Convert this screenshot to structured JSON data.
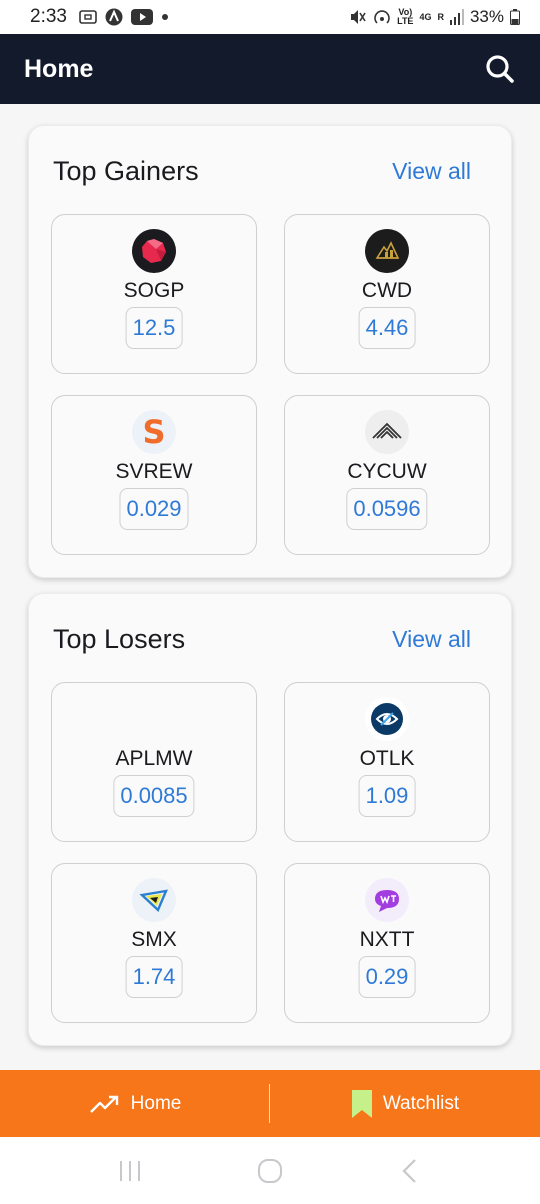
{
  "status_bar": {
    "time": "2:33",
    "battery": "33%",
    "network_top": "Vo)",
    "network_bottom": "LTE",
    "signal_type": "4G",
    "roaming": "R"
  },
  "app_bar": {
    "title": "Home"
  },
  "top_gainers": {
    "title": "Top Gainers",
    "view_all": "View all",
    "items": [
      {
        "symbol": "SOGP",
        "price": "12.5",
        "logo": "sogp-logo-icon",
        "color": "#e8294e"
      },
      {
        "symbol": "CWD",
        "price": "4.46",
        "logo": "cwd-logo-icon",
        "color": "#1c1c1c"
      },
      {
        "symbol": "SVREW",
        "price": "0.029",
        "logo": "svrew-logo-icon",
        "color": "#ef6c2a"
      },
      {
        "symbol": "CYCUW",
        "price": "0.0596",
        "logo": "cycuw-logo-icon",
        "color": "#333333"
      }
    ]
  },
  "top_losers": {
    "title": "Top Losers",
    "view_all": "View all",
    "items": [
      {
        "symbol": "APLMW",
        "price": "0.0085",
        "logo": ""
      },
      {
        "symbol": "OTLK",
        "price": "1.09",
        "logo": "otlk-logo-icon",
        "color": "#0b3a66"
      },
      {
        "symbol": "SMX",
        "price": "1.74",
        "logo": "smx-logo-icon",
        "color": "#2a7fd0"
      },
      {
        "symbol": "NXTT",
        "price": "0.29",
        "logo": "nxtt-logo-icon",
        "color": "#a23de0"
      }
    ]
  },
  "bottom_nav": {
    "home": "Home",
    "watchlist": "Watchlist"
  },
  "colors": {
    "app_bar": "#121a2c",
    "accent": "#2f7ad6",
    "nav_bg": "#f7761a"
  }
}
